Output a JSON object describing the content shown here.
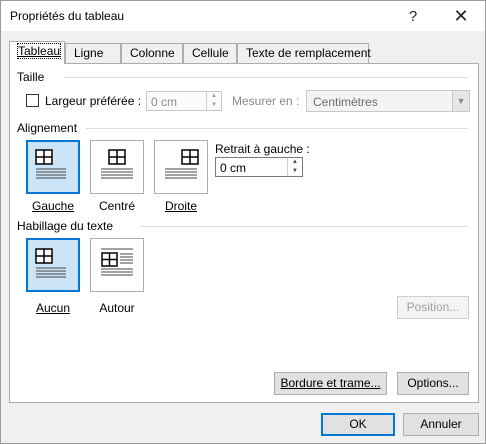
{
  "window": {
    "title": "Propriétés du tableau",
    "help_glyph": "?",
    "close_glyph": "✕"
  },
  "tabs": [
    {
      "label": "Tableau",
      "active": true
    },
    {
      "label": "Ligne",
      "active": false
    },
    {
      "label": "Colonne",
      "active": false
    },
    {
      "label": "Cellule",
      "active": false
    },
    {
      "label": "Texte de remplacement",
      "active": false
    }
  ],
  "taille": {
    "heading": "Taille",
    "preferred_width_label": "Largeur préférée :",
    "preferred_width_checked": false,
    "preferred_width_value": "0 cm",
    "measure_label": "Mesurer en :",
    "measure_value": "Centimètres"
  },
  "alignement": {
    "heading": "Alignement",
    "options": [
      "Gauche",
      "Centré",
      "Droite"
    ],
    "selected": "Gauche",
    "indent_label": "Retrait à gauche :",
    "indent_value": "0 cm"
  },
  "habillage": {
    "heading": "Habillage du texte",
    "options": [
      "Aucun",
      "Autour"
    ],
    "selected": "Aucun",
    "position_button": "Position..."
  },
  "buttons": {
    "borders": "Bordure et trame...",
    "options": "Options...",
    "ok": "OK",
    "cancel": "Annuler"
  }
}
